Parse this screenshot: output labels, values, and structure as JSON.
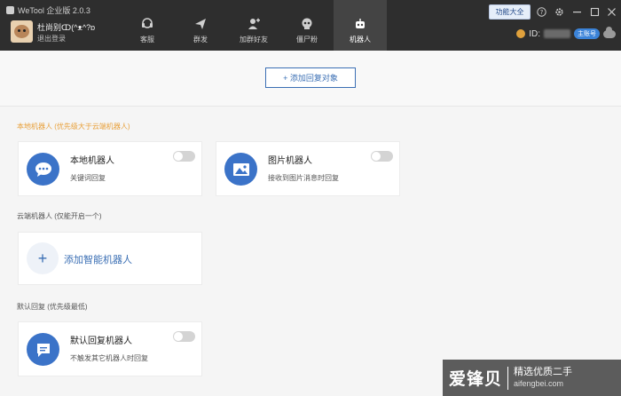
{
  "app": {
    "title": "WeTool 企业版 2.0.3"
  },
  "user": {
    "name": "杜尚别ↀ(^ᴥ^?ɒ",
    "logout": "退出登录"
  },
  "nav": [
    {
      "label": "客服",
      "icon": "headset-icon",
      "active": false
    },
    {
      "label": "群发",
      "icon": "paper-plane-icon",
      "active": false
    },
    {
      "label": "加群好友",
      "icon": "add-friend-icon",
      "active": false
    },
    {
      "label": "僵尸粉",
      "icon": "skull-icon",
      "active": false
    },
    {
      "label": "机器人",
      "icon": "robot-icon",
      "active": true
    }
  ],
  "header_right": {
    "func_button": "功能大全",
    "id_label": "ID:",
    "account_badge": "主账号"
  },
  "main": {
    "add_target_button": "+ 添加回复对象",
    "local_section": "本地机器人 (优先级大于云端机器人)",
    "cloud_section": "云端机器人 (仅能开启一个)",
    "default_section": "默认回复 (优先级最低)",
    "cards": {
      "local_robot": {
        "title": "本地机器人",
        "desc": "关键词回复",
        "icon": "chat-bubble-icon",
        "enabled": false
      },
      "image_robot": {
        "title": "图片机器人",
        "desc": "接收到图片消息时回复",
        "icon": "image-icon",
        "enabled": false
      },
      "add_smart": {
        "label": "添加智能机器人"
      },
      "default_robot": {
        "title": "默认回复机器人",
        "desc": "不触发其它机器人时回复",
        "icon": "message-icon",
        "enabled": false
      }
    }
  },
  "watermark": {
    "main": "爱锋贝",
    "line1": "精选优质二手",
    "line2": "aifengbei.com"
  },
  "colors": {
    "header": "#2e2e2e",
    "accent": "#3b73c8",
    "section_highlight": "#e8a03a"
  }
}
